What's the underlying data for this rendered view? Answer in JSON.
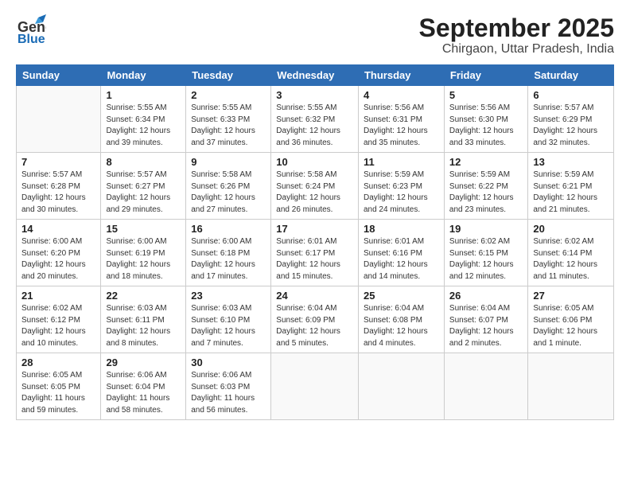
{
  "header": {
    "logo_main": "General",
    "logo_sub": "Blue",
    "title": "September 2025",
    "subtitle": "Chirgaon, Uttar Pradesh, India"
  },
  "weekdays": [
    "Sunday",
    "Monday",
    "Tuesday",
    "Wednesday",
    "Thursday",
    "Friday",
    "Saturday"
  ],
  "weeks": [
    [
      {
        "day": "",
        "info": ""
      },
      {
        "day": "1",
        "info": "Sunrise: 5:55 AM\nSunset: 6:34 PM\nDaylight: 12 hours\nand 39 minutes."
      },
      {
        "day": "2",
        "info": "Sunrise: 5:55 AM\nSunset: 6:33 PM\nDaylight: 12 hours\nand 37 minutes."
      },
      {
        "day": "3",
        "info": "Sunrise: 5:55 AM\nSunset: 6:32 PM\nDaylight: 12 hours\nand 36 minutes."
      },
      {
        "day": "4",
        "info": "Sunrise: 5:56 AM\nSunset: 6:31 PM\nDaylight: 12 hours\nand 35 minutes."
      },
      {
        "day": "5",
        "info": "Sunrise: 5:56 AM\nSunset: 6:30 PM\nDaylight: 12 hours\nand 33 minutes."
      },
      {
        "day": "6",
        "info": "Sunrise: 5:57 AM\nSunset: 6:29 PM\nDaylight: 12 hours\nand 32 minutes."
      }
    ],
    [
      {
        "day": "7",
        "info": "Sunrise: 5:57 AM\nSunset: 6:28 PM\nDaylight: 12 hours\nand 30 minutes."
      },
      {
        "day": "8",
        "info": "Sunrise: 5:57 AM\nSunset: 6:27 PM\nDaylight: 12 hours\nand 29 minutes."
      },
      {
        "day": "9",
        "info": "Sunrise: 5:58 AM\nSunset: 6:26 PM\nDaylight: 12 hours\nand 27 minutes."
      },
      {
        "day": "10",
        "info": "Sunrise: 5:58 AM\nSunset: 6:24 PM\nDaylight: 12 hours\nand 26 minutes."
      },
      {
        "day": "11",
        "info": "Sunrise: 5:59 AM\nSunset: 6:23 PM\nDaylight: 12 hours\nand 24 minutes."
      },
      {
        "day": "12",
        "info": "Sunrise: 5:59 AM\nSunset: 6:22 PM\nDaylight: 12 hours\nand 23 minutes."
      },
      {
        "day": "13",
        "info": "Sunrise: 5:59 AM\nSunset: 6:21 PM\nDaylight: 12 hours\nand 21 minutes."
      }
    ],
    [
      {
        "day": "14",
        "info": "Sunrise: 6:00 AM\nSunset: 6:20 PM\nDaylight: 12 hours\nand 20 minutes."
      },
      {
        "day": "15",
        "info": "Sunrise: 6:00 AM\nSunset: 6:19 PM\nDaylight: 12 hours\nand 18 minutes."
      },
      {
        "day": "16",
        "info": "Sunrise: 6:00 AM\nSunset: 6:18 PM\nDaylight: 12 hours\nand 17 minutes."
      },
      {
        "day": "17",
        "info": "Sunrise: 6:01 AM\nSunset: 6:17 PM\nDaylight: 12 hours\nand 15 minutes."
      },
      {
        "day": "18",
        "info": "Sunrise: 6:01 AM\nSunset: 6:16 PM\nDaylight: 12 hours\nand 14 minutes."
      },
      {
        "day": "19",
        "info": "Sunrise: 6:02 AM\nSunset: 6:15 PM\nDaylight: 12 hours\nand 12 minutes."
      },
      {
        "day": "20",
        "info": "Sunrise: 6:02 AM\nSunset: 6:14 PM\nDaylight: 12 hours\nand 11 minutes."
      }
    ],
    [
      {
        "day": "21",
        "info": "Sunrise: 6:02 AM\nSunset: 6:12 PM\nDaylight: 12 hours\nand 10 minutes."
      },
      {
        "day": "22",
        "info": "Sunrise: 6:03 AM\nSunset: 6:11 PM\nDaylight: 12 hours\nand 8 minutes."
      },
      {
        "day": "23",
        "info": "Sunrise: 6:03 AM\nSunset: 6:10 PM\nDaylight: 12 hours\nand 7 minutes."
      },
      {
        "day": "24",
        "info": "Sunrise: 6:04 AM\nSunset: 6:09 PM\nDaylight: 12 hours\nand 5 minutes."
      },
      {
        "day": "25",
        "info": "Sunrise: 6:04 AM\nSunset: 6:08 PM\nDaylight: 12 hours\nand 4 minutes."
      },
      {
        "day": "26",
        "info": "Sunrise: 6:04 AM\nSunset: 6:07 PM\nDaylight: 12 hours\nand 2 minutes."
      },
      {
        "day": "27",
        "info": "Sunrise: 6:05 AM\nSunset: 6:06 PM\nDaylight: 12 hours\nand 1 minute."
      }
    ],
    [
      {
        "day": "28",
        "info": "Sunrise: 6:05 AM\nSunset: 6:05 PM\nDaylight: 11 hours\nand 59 minutes."
      },
      {
        "day": "29",
        "info": "Sunrise: 6:06 AM\nSunset: 6:04 PM\nDaylight: 11 hours\nand 58 minutes."
      },
      {
        "day": "30",
        "info": "Sunrise: 6:06 AM\nSunset: 6:03 PM\nDaylight: 11 hours\nand 56 minutes."
      },
      {
        "day": "",
        "info": ""
      },
      {
        "day": "",
        "info": ""
      },
      {
        "day": "",
        "info": ""
      },
      {
        "day": "",
        "info": ""
      }
    ]
  ]
}
